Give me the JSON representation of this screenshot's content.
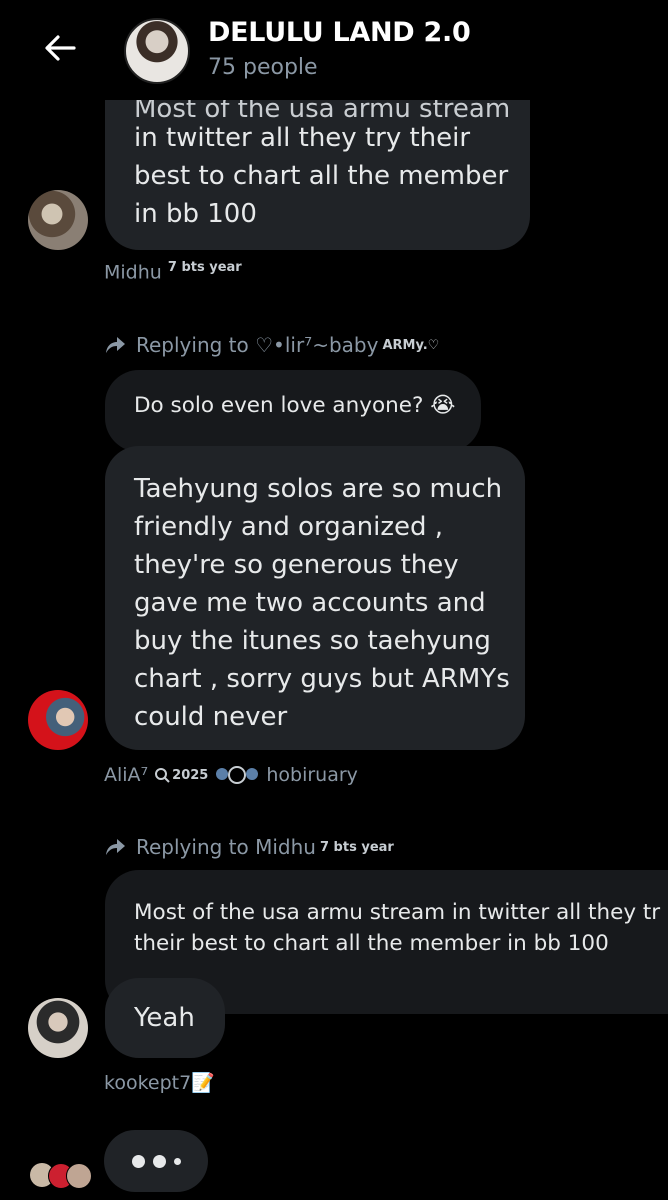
{
  "header": {
    "title": "DELULU LAND 2.0",
    "subtitle": "75 people"
  },
  "messages": [
    {
      "cut_line": "Most of the usa armu stream",
      "text": "in twitter all they try their\nbest to chart all the member\nin bb 100",
      "author": "Midhu",
      "author_badge": "7 bts year"
    },
    {
      "reply_to": "Replying to ♡•lir⁷~baby",
      "reply_badge": "ARMy.♡",
      "quoted_text": "Do solo even love anyone?",
      "quoted_emoji": "😭",
      "text": "Taehyung solos are so much\nfriendly and organized ,\nthey're so generous they\ngave me two accounts and\nbuy the itunes so taehyung\nchart , sorry guys but ARMYs\ncould never",
      "author": "AliA⁷",
      "author_badge": "2025",
      "author_suffix": "hobiruary"
    },
    {
      "reply_to": "Replying to Midhu",
      "reply_badge": "7 bts year",
      "quoted_text": "Most of the usa armu stream in twitter all they tr\ntheir best to chart all the member in bb 100",
      "text": "Yeah",
      "author": "kookept7",
      "author_emoji": "📝"
    }
  ],
  "typing_indicator": "•••"
}
